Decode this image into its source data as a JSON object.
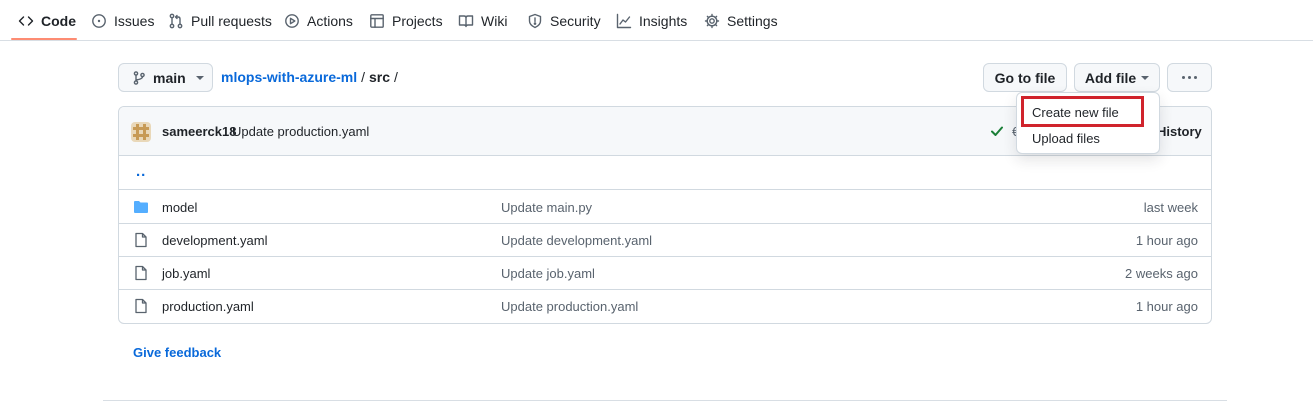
{
  "repo_nav": {
    "tabs": [
      {
        "label": "Code",
        "icon": "code-icon",
        "active": true
      },
      {
        "label": "Issues",
        "icon": "issue-icon"
      },
      {
        "label": "Pull requests",
        "icon": "pull-request-icon"
      },
      {
        "label": "Actions",
        "icon": "play-icon"
      },
      {
        "label": "Projects",
        "icon": "table-icon"
      },
      {
        "label": "Wiki",
        "icon": "book-icon"
      },
      {
        "label": "Security",
        "icon": "shield-icon"
      },
      {
        "label": "Insights",
        "icon": "graph-icon"
      },
      {
        "label": "Settings",
        "icon": "gear-icon"
      }
    ],
    "accent_color": "#fd8c73"
  },
  "toolbar": {
    "branch": "main",
    "breadcrumb": {
      "repo": "mlops-with-azure-ml",
      "separator": "/",
      "folder": "src",
      "trailing": "/"
    },
    "goto_file_label": "Go to file",
    "add_file_label": "Add file"
  },
  "commit": {
    "author": "sameerck18",
    "message": "Update production.yaml",
    "hash_visible": "€",
    "history_label": "History",
    "status_color": "#1a7f37"
  },
  "parent_dir": "..",
  "files": [
    {
      "type": "folder",
      "name": "model",
      "commit": "Update main.py",
      "date": "last week"
    },
    {
      "type": "file",
      "name": "development.yaml",
      "commit": "Update development.yaml",
      "date": "1 hour ago"
    },
    {
      "type": "file",
      "name": "job.yaml",
      "commit": "Update job.yaml",
      "date": "2 weeks ago"
    },
    {
      "type": "file",
      "name": "production.yaml",
      "commit": "Update production.yaml",
      "date": "1 hour ago"
    }
  ],
  "add_file_menu": {
    "items": [
      "Create new file",
      "Upload files"
    ],
    "highlight_color": "#d0232c"
  },
  "feedback_label": "Give feedback",
  "colors": {
    "link": "#0969da",
    "folder": "#54aeff",
    "muted": "#59636e"
  }
}
